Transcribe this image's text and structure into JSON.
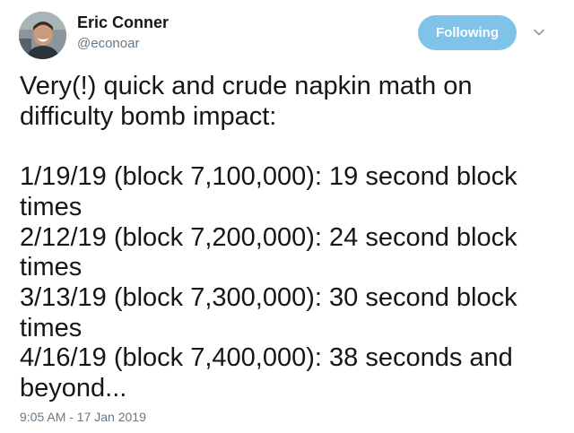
{
  "author": {
    "display_name": "Eric Conner",
    "handle": "@econoar",
    "avatar_icon": "user-avatar-photo"
  },
  "follow_button": {
    "label": "Following",
    "color": "#7fc3ea"
  },
  "menu_icon": "chevron-down-icon",
  "tweet": {
    "intro": [
      "Very(!) quick and crude napkin math on",
      "difficulty bomb impact:"
    ],
    "entries": [
      "1/19/19 (block 7,100,000): 19 second block",
      "times",
      "2/12/19 (block 7,200,000): 24 second block",
      "times",
      "3/13/19 (block 7,300,000): 30 second block",
      "times",
      "4/16/19 (block 7,400,000): 38 seconds and",
      "beyond..."
    ]
  },
  "timestamp": "9:05 AM - 17 Jan 2019"
}
